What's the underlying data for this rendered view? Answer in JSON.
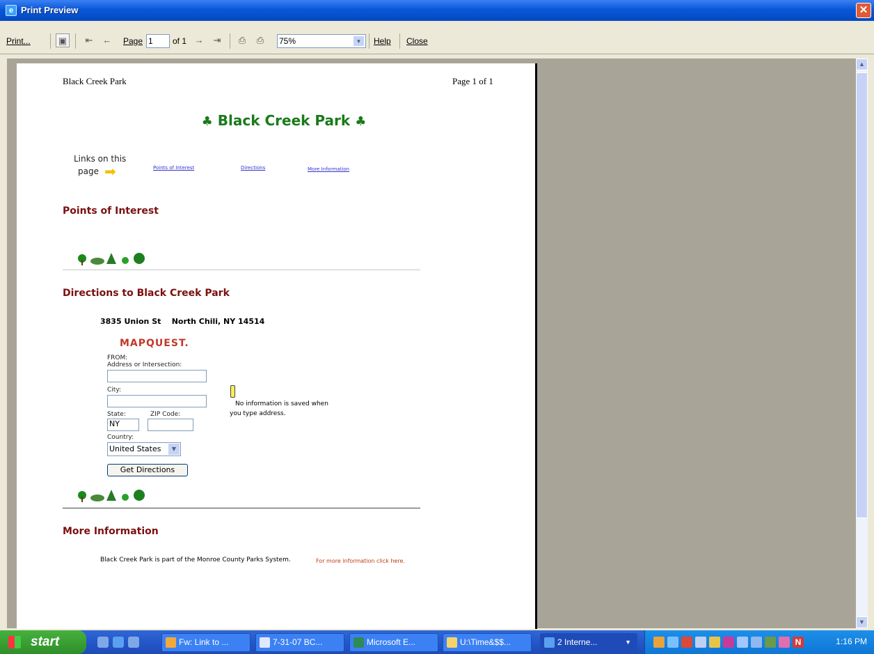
{
  "window": {
    "title": "Print Preview",
    "close_glyph": "✕"
  },
  "toolbar": {
    "print_label": "Print...",
    "page_label": "Page",
    "page_value": "1",
    "of_label": "of 1",
    "zoom_value": "75%",
    "help_label": "Help",
    "close_label": "Close",
    "icons": [
      "page-setup-icon",
      "first-page-icon",
      "previous-page-icon",
      "next-page-icon",
      "last-page-icon",
      "one-page-icon",
      "two-page-icon"
    ]
  },
  "page": {
    "header_left": "Black Creek Park",
    "header_right": "Page 1 of 1",
    "title": "Black Creek Park",
    "links_caption_1": "Links on this",
    "links_caption_2": "page",
    "links": [
      "Points of Interest",
      "Directions",
      "More Information"
    ],
    "sections": {
      "poi_heading": "Points of Interest",
      "directions_heading": "Directions to Black Creek Park",
      "address": "3835 Union St    North Chili, NY 14514",
      "more_heading": "More Information",
      "more_text": "Black Creek Park is part of the Monroe County Parks System.",
      "more_link": "For more information click here."
    },
    "form": {
      "logo": "MAPQUEST.",
      "from_label": "FROM:",
      "address_label": "Address or Intersection:",
      "city_label": "City:",
      "state_label": "State:",
      "state_value": "NY",
      "zip_label": "ZIP Code:",
      "country_label": "Country:",
      "country_value": "United States",
      "submit": "Get Directions",
      "note_1": "No information is saved when",
      "note_2": "you type address."
    }
  },
  "taskbar": {
    "start": "start",
    "tasks": [
      "Fw: Link to ...",
      "7-31-07 BC...",
      "Microsoft E...",
      "U:\\Time&$$...",
      "2 Interne..."
    ],
    "clock": "1:16 PM"
  },
  "colors": {
    "title_bar": "#0a58d8",
    "heading": "#7a1010",
    "link": "#3333cc",
    "park_green": "#1a7a1a",
    "taskbar": "#2457c9"
  }
}
